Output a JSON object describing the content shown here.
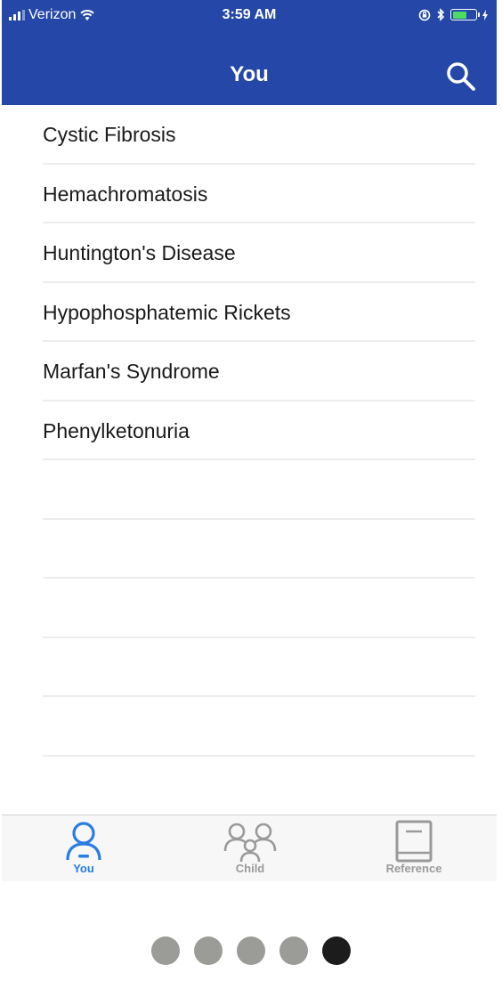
{
  "status_bar": {
    "carrier": "Verizon",
    "time": "3:59 AM",
    "battery_fill_fraction": 0.55
  },
  "header": {
    "title": "You",
    "search_icon": "search-icon",
    "background_color": "#2548a8"
  },
  "list": {
    "items": [
      {
        "label": "Cystic Fibrosis"
      },
      {
        "label": "Hemachromatosis"
      },
      {
        "label": "Huntington's Disease"
      },
      {
        "label": "Hypophosphatemic Rickets"
      },
      {
        "label": "Marfan's Syndrome"
      },
      {
        "label": "Phenylketonuria"
      },
      {
        "label": ""
      },
      {
        "label": ""
      },
      {
        "label": ""
      },
      {
        "label": ""
      },
      {
        "label": ""
      },
      {
        "label": ""
      }
    ]
  },
  "tabbar": {
    "tabs": [
      {
        "label": "You",
        "icon": "person-icon",
        "active": true
      },
      {
        "label": "Child",
        "icon": "family-icon",
        "active": false
      },
      {
        "label": "Reference",
        "icon": "book-icon",
        "active": false
      }
    ],
    "active_color": "#2a7de1",
    "inactive_color": "#9a9a9a"
  },
  "pager": {
    "count": 5,
    "current_index": 4
  }
}
